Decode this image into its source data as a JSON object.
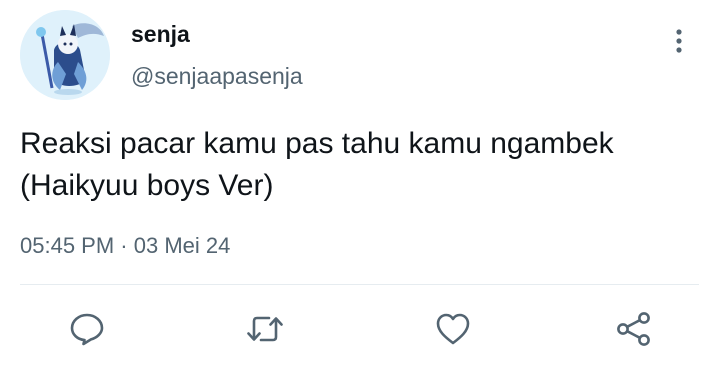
{
  "tweet": {
    "author": {
      "display_name": "senja",
      "handle": "@senjaapasenja",
      "avatar_icon": "anime-character-avatar"
    },
    "text": "Reaksi pacar kamu pas tahu kamu ngambek (Haikyuu boys Ver)",
    "time": "05:45 PM",
    "separator": "·",
    "date": "03 Mei 24"
  },
  "menu_icon": "more-vertical-icon",
  "actions": [
    {
      "name": "reply",
      "icon": "reply-icon"
    },
    {
      "name": "retweet",
      "icon": "retweet-icon"
    },
    {
      "name": "like",
      "icon": "heart-icon"
    },
    {
      "name": "share",
      "icon": "share-icon"
    }
  ],
  "colors": {
    "text_primary": "#0f1419",
    "text_secondary": "#536471",
    "icon": "#536471",
    "divider": "#e6ecf0"
  }
}
